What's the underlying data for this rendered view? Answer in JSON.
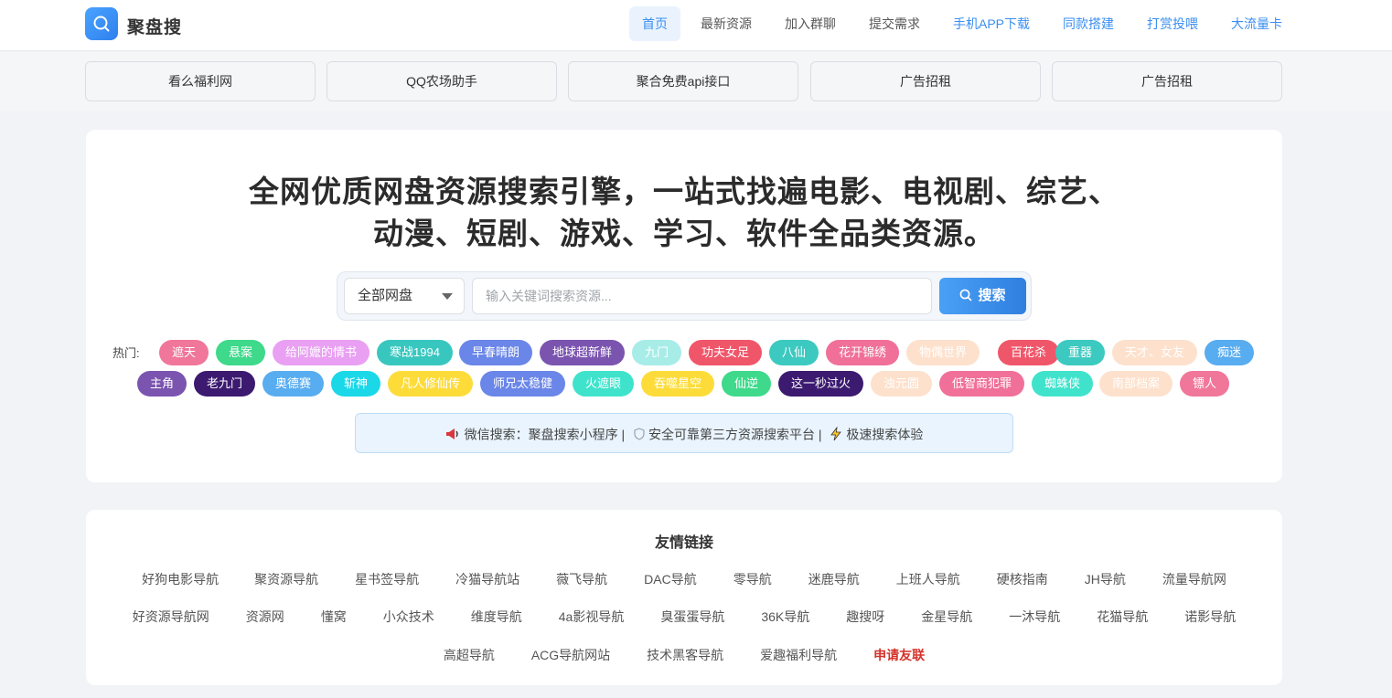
{
  "header": {
    "brand": "聚盘搜",
    "nav": [
      {
        "label": "首页",
        "style": "active"
      },
      {
        "label": "最新资源",
        "style": ""
      },
      {
        "label": "加入群聊",
        "style": ""
      },
      {
        "label": "提交需求",
        "style": ""
      },
      {
        "label": "手机APP下载",
        "style": "blue"
      },
      {
        "label": "同款搭建",
        "style": "blue"
      },
      {
        "label": "打赏投喂",
        "style": "blue"
      },
      {
        "label": "大流量卡",
        "style": "blue"
      }
    ]
  },
  "ads": [
    "看么福利网",
    "QQ农场助手",
    "聚合免费api接口",
    "广告招租",
    "广告招租"
  ],
  "hero": {
    "title_line1": "全网优质网盘资源搜索引擎，一站式找遍电影、电视剧、综艺、",
    "title_line2": "动漫、短剧、游戏、学习、软件全品类资源。"
  },
  "search": {
    "select_value": "全部网盘",
    "placeholder": "输入关键词搜索资源...",
    "button_label": "搜索"
  },
  "hot": {
    "label": "热门:",
    "tags": [
      {
        "text": "遮天",
        "color": "#f0769a"
      },
      {
        "text": "悬案",
        "color": "#3ed98a"
      },
      {
        "text": "给阿嬷的情书",
        "color": "#e9a0f3"
      },
      {
        "text": "寒战1994",
        "color": "#38c7bf"
      },
      {
        "text": "早春晴朗",
        "color": "#6a86e8"
      },
      {
        "text": "地球超新鲜",
        "color": "#7b54b0"
      },
      {
        "text": "九门",
        "color": "#a8ece8"
      },
      {
        "text": "功夫女足",
        "color": "#f0566a"
      },
      {
        "text": "八仙",
        "color": "#3cc9c0"
      },
      {
        "text": "花开锦绣",
        "color": "#f0709a"
      },
      {
        "text": "物偶世界",
        "color": "#fde1cc"
      },
      {
        "text": "百花杀",
        "color": "#f0566a"
      },
      {
        "text": "重器",
        "color": "#3cc9c0"
      },
      {
        "text": "天才、女友",
        "color": "#fde1cc"
      },
      {
        "text": "痴迷",
        "color": "#58acf0"
      },
      {
        "text": "主角",
        "color": "#7b54b0"
      },
      {
        "text": "老九门",
        "color": "#3b1a70"
      },
      {
        "text": "奥德赛",
        "color": "#58acf0"
      },
      {
        "text": "斩神",
        "color": "#1ad8e8"
      },
      {
        "text": "凡人修仙传",
        "color": "#fddc3a"
      },
      {
        "text": "师兄太稳健",
        "color": "#6a86e8"
      },
      {
        "text": "火遮眼",
        "color": "#3fe3cc"
      },
      {
        "text": "吞噬星空",
        "color": "#fddc3a"
      },
      {
        "text": "仙逆",
        "color": "#3ed98a"
      },
      {
        "text": "这一秒过火",
        "color": "#3b1a70"
      },
      {
        "text": "浊元圆",
        "color": "#fde1cc"
      },
      {
        "text": "低智商犯罪",
        "color": "#f0709a"
      },
      {
        "text": "蜘蛛侠",
        "color": "#3fe3cc"
      },
      {
        "text": "南部档案",
        "color": "#fde1cc"
      },
      {
        "text": "镖人",
        "color": "#f0769a"
      }
    ]
  },
  "notice": {
    "prefix": "微信搜索：聚盘搜索小程序 |",
    "middle": "安全可靠第三方资源搜索平台 |",
    "suffix": "极速搜索体验"
  },
  "friend_links": {
    "title": "友情链接",
    "rows": [
      [
        "好狗电影导航",
        "聚资源导航",
        "星书签导航",
        "冷猫导航站",
        "薇飞导航",
        "DAC导航",
        "零导航",
        "迷鹿导航",
        "上班人导航",
        "硬核指南",
        "JH导航",
        "流量导航网"
      ],
      [
        "好资源导航网",
        "资源网",
        "懂窝",
        "小众技术",
        "维度导航",
        "4a影视导航",
        "臭蛋蛋导航",
        "36K导航",
        "趣搜呀",
        "金星导航",
        "一沐导航",
        "花猫导航",
        "诺影导航"
      ],
      [
        "高超导航",
        "ACG导航网站",
        "技术黑客导航",
        "爱趣福利导航"
      ]
    ],
    "apply_label": "申请友联"
  }
}
